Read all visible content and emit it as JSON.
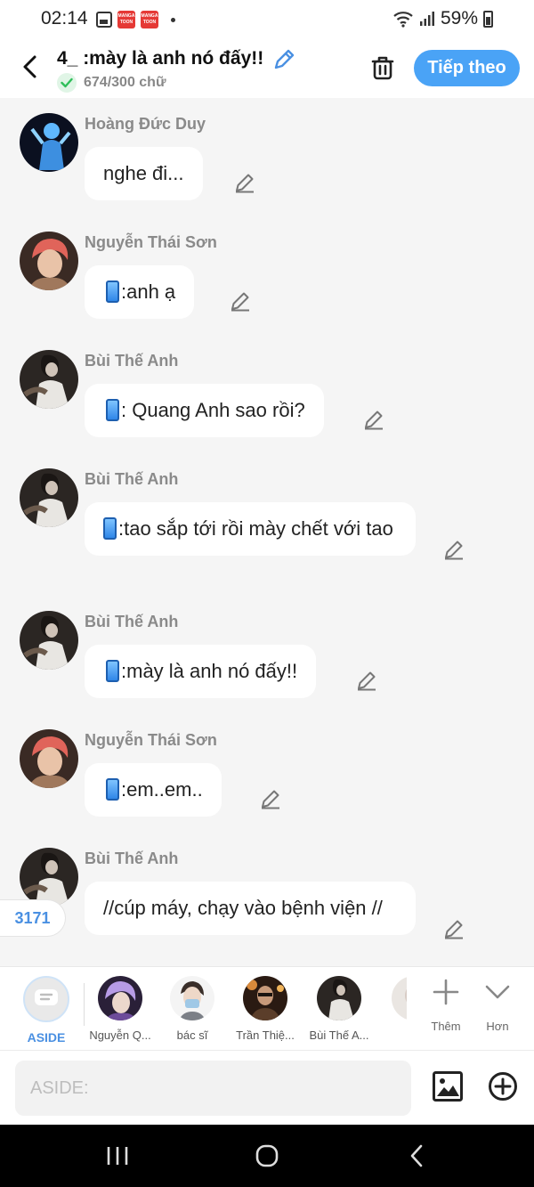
{
  "status_bar": {
    "time": "02:14",
    "app_badge": "MANGA TOON",
    "battery": "59%"
  },
  "header": {
    "title": "4_ :mày là anh nó đấy!!",
    "char_count": "674/300 chữ",
    "next_label": "Tiếp theo"
  },
  "messages": [
    {
      "sender": "Hoàng Đức Duy",
      "text": "nghe đi...",
      "phone": false,
      "avatar": "blue-figure"
    },
    {
      "sender": "Nguyễn Thái Sơn",
      "text": ":anh ạ",
      "phone": true,
      "avatar": "pink-hair"
    },
    {
      "sender": "Bùi Thế Anh",
      "text": ": Quang Anh sao rồi?",
      "phone": true,
      "avatar": "dark-photo"
    },
    {
      "sender": "Bùi Thế Anh",
      "text": ":tao sắp tới rồi mày chết với tao",
      "phone": true,
      "avatar": "dark-photo"
    },
    {
      "sender": "Bùi Thế Anh",
      "text": ":mày là anh nó đấy!!",
      "phone": true,
      "avatar": "dark-photo"
    },
    {
      "sender": "Nguyễn Thái Sơn",
      "text": ":em..em..",
      "phone": true,
      "avatar": "pink-hair"
    },
    {
      "sender": "Bùi Thế Anh",
      "text": "//cúp máy, chạy vào bệnh viện //",
      "phone": false,
      "avatar": "dark-photo"
    }
  ],
  "counter": "3171",
  "character_bar": {
    "aside_label": "ASIDE",
    "characters": [
      {
        "label": "Nguyễn Q...",
        "avatar": "purple-hair"
      },
      {
        "label": "bác sĩ",
        "avatar": "masked"
      },
      {
        "label": "Trần Thiệ...",
        "avatar": "dark-warm"
      },
      {
        "label": "Bùi Thế A...",
        "avatar": "dark-photo"
      }
    ],
    "add_label": "Thêm",
    "more_label": "Hơn"
  },
  "input": {
    "placeholder": "ASIDE:"
  },
  "colors": {
    "accent": "#4aa3f6",
    "bubble": "#ffffff",
    "background": "#f5f5f5",
    "sender": "#8a8a8a"
  },
  "icons": [
    "back-arrow-icon",
    "pencil-icon",
    "check-icon",
    "trash-icon",
    "image-icon",
    "plus-circle-icon",
    "plus-icon",
    "chevron-down-icon",
    "phone-icon"
  ]
}
